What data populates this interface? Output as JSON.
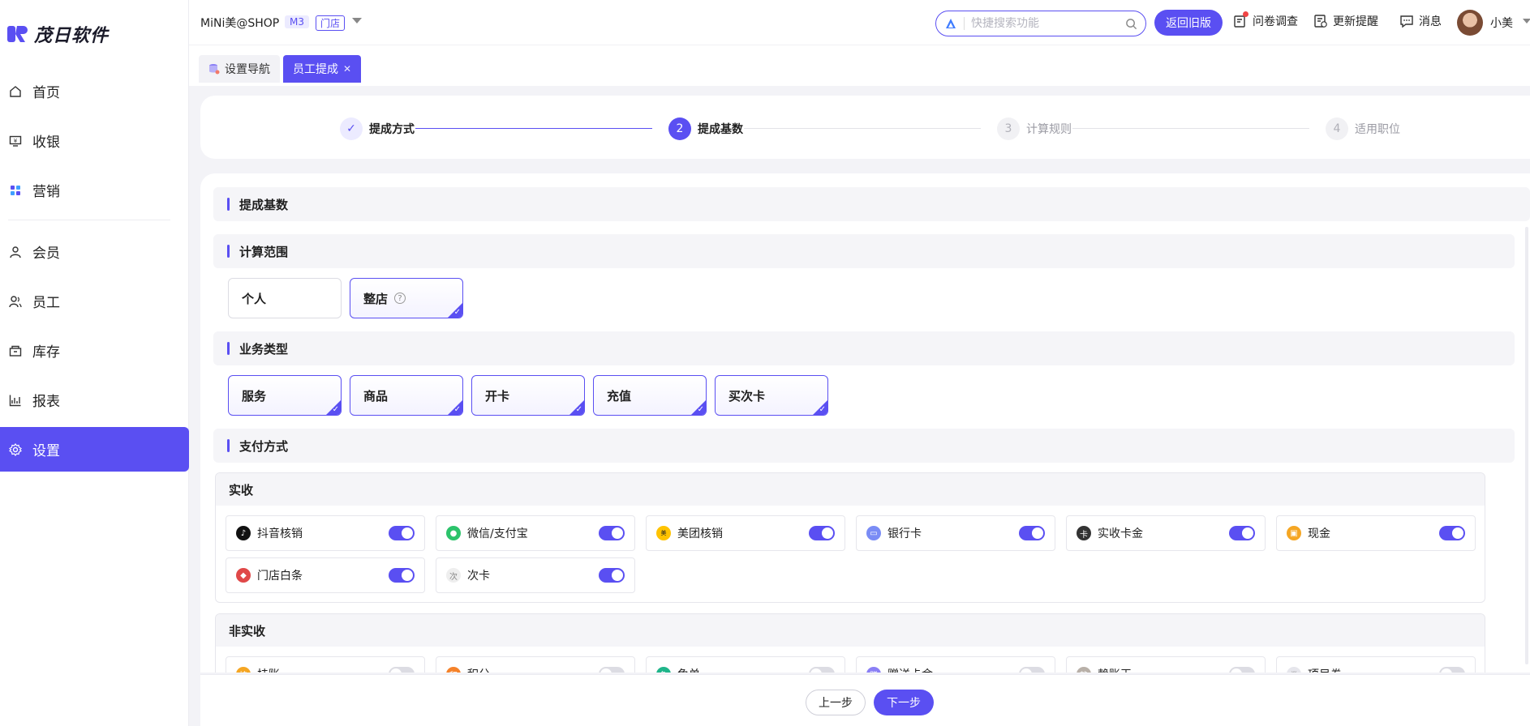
{
  "app": {
    "logo_text": "茂日软件",
    "brand_color": "#5a4ff2"
  },
  "sidebar": {
    "items": [
      {
        "label": "首页",
        "icon": "home-icon"
      },
      {
        "label": "收银",
        "icon": "cashier-icon"
      },
      {
        "label": "营销",
        "icon": "marketing-icon"
      },
      {
        "label": "会员",
        "icon": "member-icon"
      },
      {
        "label": "员工",
        "icon": "staff-icon"
      },
      {
        "label": "库存",
        "icon": "inventory-icon"
      },
      {
        "label": "报表",
        "icon": "report-icon"
      },
      {
        "label": "设置",
        "icon": "settings-icon",
        "active": true
      }
    ]
  },
  "header": {
    "shop_name": "MiNi美@SHOP",
    "badge_level": "M3",
    "badge_store": "门店",
    "search_placeholder": "快捷搜索功能",
    "back_old_label": "返回旧版",
    "survey_label": "问卷调查",
    "update_label": "更新提醒",
    "message_label": "消息",
    "user_name": "小美"
  },
  "tabs": [
    {
      "label": "设置导航",
      "active": false
    },
    {
      "label": "员工提成",
      "active": true
    }
  ],
  "steps": [
    {
      "number": "1",
      "label": "提成方式",
      "state": "done"
    },
    {
      "number": "2",
      "label": "提成基数",
      "state": "current"
    },
    {
      "number": "3",
      "label": "计算规则",
      "state": "todo"
    },
    {
      "number": "4",
      "label": "适用职位",
      "state": "todo"
    }
  ],
  "main": {
    "title": "提成基数",
    "scope": {
      "title": "计算范围",
      "options": [
        {
          "label": "个人",
          "selected": false
        },
        {
          "label": "整店",
          "selected": true
        }
      ]
    },
    "business": {
      "title": "业务类型",
      "options": [
        {
          "label": "服务",
          "selected": true
        },
        {
          "label": "商品",
          "selected": true
        },
        {
          "label": "开卡",
          "selected": true
        },
        {
          "label": "充值",
          "selected": true
        },
        {
          "label": "买次卡",
          "selected": true
        }
      ]
    },
    "payment": {
      "title": "支付方式",
      "actual": {
        "title": "实收",
        "items": [
          {
            "label": "抖音核销",
            "icon": "douyin-icon",
            "on": true
          },
          {
            "label": "微信/支付宝",
            "icon": "wechat-alipay-icon",
            "on": true
          },
          {
            "label": "美团核销",
            "icon": "meituan-icon",
            "on": true
          },
          {
            "label": "银行卡",
            "icon": "bank-card-icon",
            "on": true
          },
          {
            "label": "实收卡金",
            "icon": "card-money-icon",
            "on": true
          },
          {
            "label": "现金",
            "icon": "cash-icon",
            "on": true
          },
          {
            "label": "门店白条",
            "icon": "store-credit-icon",
            "on": true
          },
          {
            "label": "次卡",
            "icon": "times-card-icon",
            "on": true
          }
        ]
      },
      "non_actual": {
        "title": "非实收",
        "items": [
          {
            "label": "挂账",
            "icon": "credit-icon",
            "on": false
          },
          {
            "label": "积分",
            "icon": "points-icon",
            "on": false
          },
          {
            "label": "免单",
            "icon": "free-icon",
            "on": false
          },
          {
            "label": "赠送卡金",
            "icon": "gift-card-icon",
            "on": false
          },
          {
            "label": "赖账王",
            "icon": "bad-debt-icon",
            "on": false
          },
          {
            "label": "项目券",
            "icon": "voucher-icon",
            "on": false
          }
        ]
      }
    }
  },
  "footer": {
    "prev_label": "上一步",
    "next_label": "下一步"
  }
}
